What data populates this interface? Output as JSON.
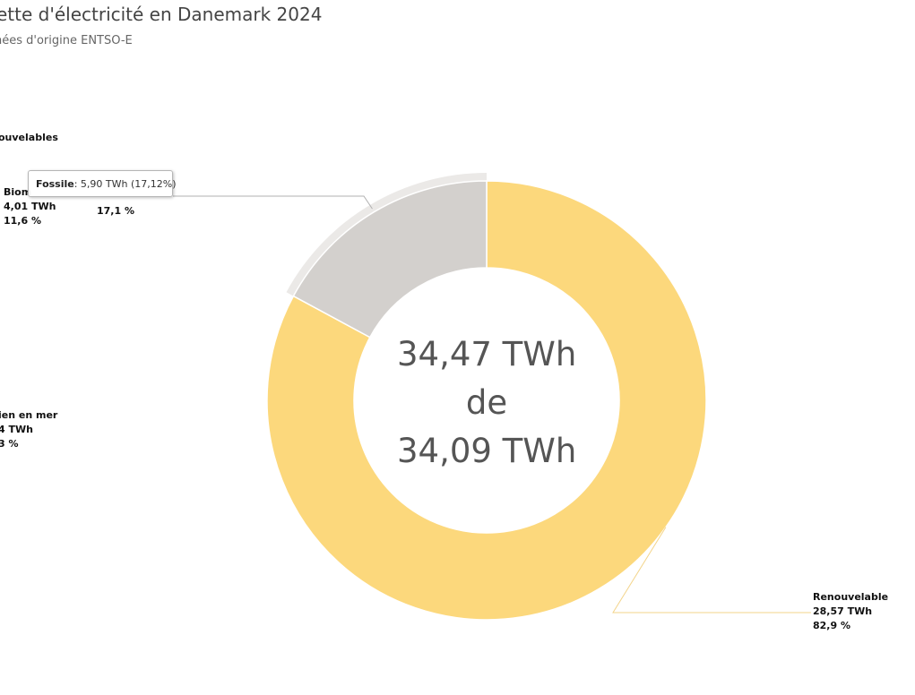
{
  "header": {
    "title": "ette d'électricité en Danemark 2024",
    "subtitle": "nées d'origine ENTSO-E"
  },
  "center": {
    "line1": "34,47 TWh",
    "line2": "de",
    "line3": "34,09 TWh"
  },
  "tooltip": {
    "name": "Fossile",
    "value": ": 5,90 TWh (17,12%)"
  },
  "colors": {
    "renewable": "#fcd87c",
    "fossil": "#d3d0cd",
    "fossil_halo": "#ebe9e7",
    "connector_fossil": "#b0b0b0",
    "connector_renewable": "#f3d48a"
  },
  "chart_data": {
    "type": "pie",
    "title": "ette d'électricité en Danemark 2024",
    "subtitle": "nées d'origine ENTSO-E",
    "unit": "TWh",
    "inner_series": [
      {
        "name": "Renouvelable",
        "value": 28.57,
        "percent_label": "82,9 %",
        "value_label": "28,57 TWh"
      },
      {
        "name": "Fossile",
        "value": 5.9,
        "percent_label": "17,1 %"
      }
    ],
    "outer_labels_partial": {
      "group_label": "ouvelables",
      "items": [
        {
          "name": "Biom",
          "value_label": "4,01 TWh",
          "percent_label": "11,6 %"
        },
        {
          "name": "ien en mer",
          "value_label": "4 TWh",
          "percent_label": "3 %"
        }
      ]
    },
    "center_text": [
      "34,47 TWh",
      "de",
      "34,09 TWh"
    ]
  }
}
